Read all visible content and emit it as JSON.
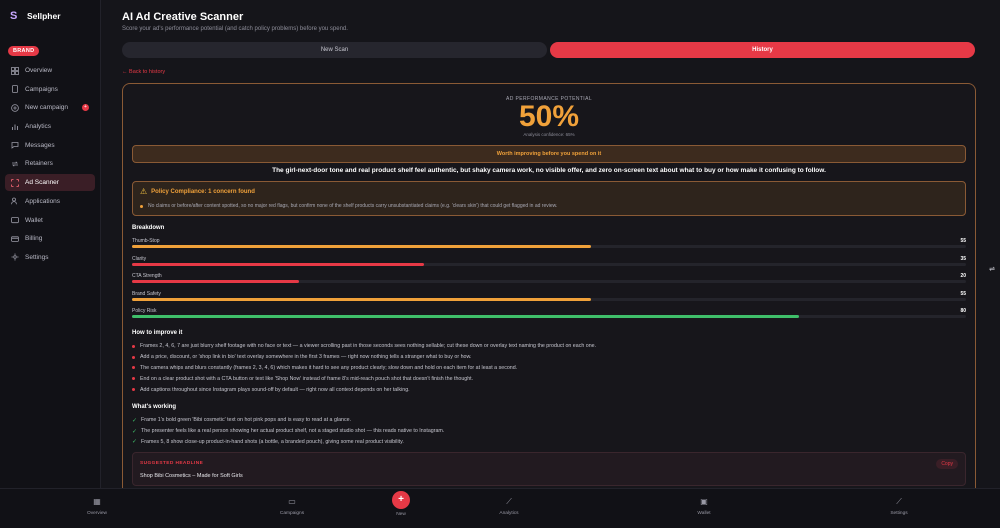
{
  "app": {
    "name": "Sellpher",
    "badge": "BRAND"
  },
  "sidebar": {
    "items": [
      {
        "label": "Overview",
        "icon": "grid-icon"
      },
      {
        "label": "Campaigns",
        "icon": "file-icon"
      },
      {
        "label": "New campaign",
        "icon": "plus-circle-icon"
      },
      {
        "label": "Analytics",
        "icon": "bar-chart-icon"
      },
      {
        "label": "Messages",
        "icon": "message-icon"
      },
      {
        "label": "Retainers",
        "icon": "repeat-icon"
      },
      {
        "label": "Ad Scanner",
        "icon": "scan-icon",
        "active": true
      },
      {
        "label": "Applications",
        "icon": "users-icon"
      },
      {
        "label": "Wallet",
        "icon": "wallet-icon"
      },
      {
        "label": "Billing",
        "icon": "card-icon"
      },
      {
        "label": "Settings",
        "icon": "settings-icon"
      }
    ]
  },
  "header": {
    "title": "AI Ad Creative Scanner",
    "subtitle": "Score your ad's performance potential (and catch policy problems) before you spend."
  },
  "tabs": {
    "new_scan": "New Scan",
    "history": "History"
  },
  "back_link": "← Back to history",
  "result": {
    "perf_label": "AD PERFORMANCE POTENTIAL",
    "perf_value": "50%",
    "confidence": "Analysis confidence: 65%",
    "verdict": "Worth improving before you spend on it",
    "summary": "The girl-next-door tone and real product shelf feel authentic, but shaky camera work, no visible offer, and zero on-screen text about what to buy or how make it confusing to follow.",
    "policy_title": "Policy Compliance: 1 concern found",
    "policy_item": "No claims or before/after content spotted, so no major red flags, but confirm none of the shelf products carry unsubstantiated claims (e.g. 'clears skin') that could get flagged in ad review.",
    "breakdown_title": "Breakdown",
    "metrics": [
      {
        "label": "Thumb-Stop",
        "value": 55,
        "color": "#f0a13a"
      },
      {
        "label": "Clarity",
        "value": 35,
        "color": "#e63946"
      },
      {
        "label": "CTA Strength",
        "value": 20,
        "color": "#e63946"
      },
      {
        "label": "Brand Safety",
        "value": 55,
        "color": "#f0a13a"
      },
      {
        "label": "Policy Risk",
        "value": 80,
        "color": "#3fbf6a"
      }
    ],
    "improve_title": "How to improve it",
    "improve_items": [
      "Frames 2, 4, 6, 7 are just blurry shelf footage with no face or text — a viewer scrolling past in those seconds sees nothing sellable; cut these down or overlay text naming the product on each one.",
      "Add a price, discount, or 'shop link in bio' text overlay somewhere in the first 3 frames — right now nothing tells a stranger what to buy or how.",
      "The camera whips and blurs constantly (frames 2, 3, 4, 6) which makes it hard to see any product clearly; slow down and hold on each item for at least a second.",
      "End on a clear product shot with a CTA button or text like 'Shop Now' instead of frame 8's mid-reach pouch shot that doesn't finish the thought.",
      "Add captions throughout since Instagram plays sound-off by default — right now all context depends on her talking."
    ],
    "working_title": "What's working",
    "working_items": [
      "Frame 1's bold green 'Bibi cosmetic' text on hot pink pops and is easy to read at a glance.",
      "The presenter feels like a real person showing her actual product shelf, not a staged studio shot — this reads native to Instagram.",
      "Frames 5, 8 show close-up product-in-hand shots (a bottle, a branded pouch), giving some real product visibility."
    ],
    "headline_label": "SUGGESTED HEADLINE",
    "headline_text": "Shop Bibi Cosmetics – Made for Soft Girls",
    "copy_label": "Copy"
  },
  "bottom_nav": {
    "overview": "Overview",
    "campaigns": "Campaigns",
    "new": "New",
    "analytics": "Analytics",
    "wallet": "Wallet",
    "settings": "Settings"
  },
  "colors": {
    "accent": "#e63946",
    "warning": "#f0a13a",
    "success": "#3fbf6a"
  }
}
